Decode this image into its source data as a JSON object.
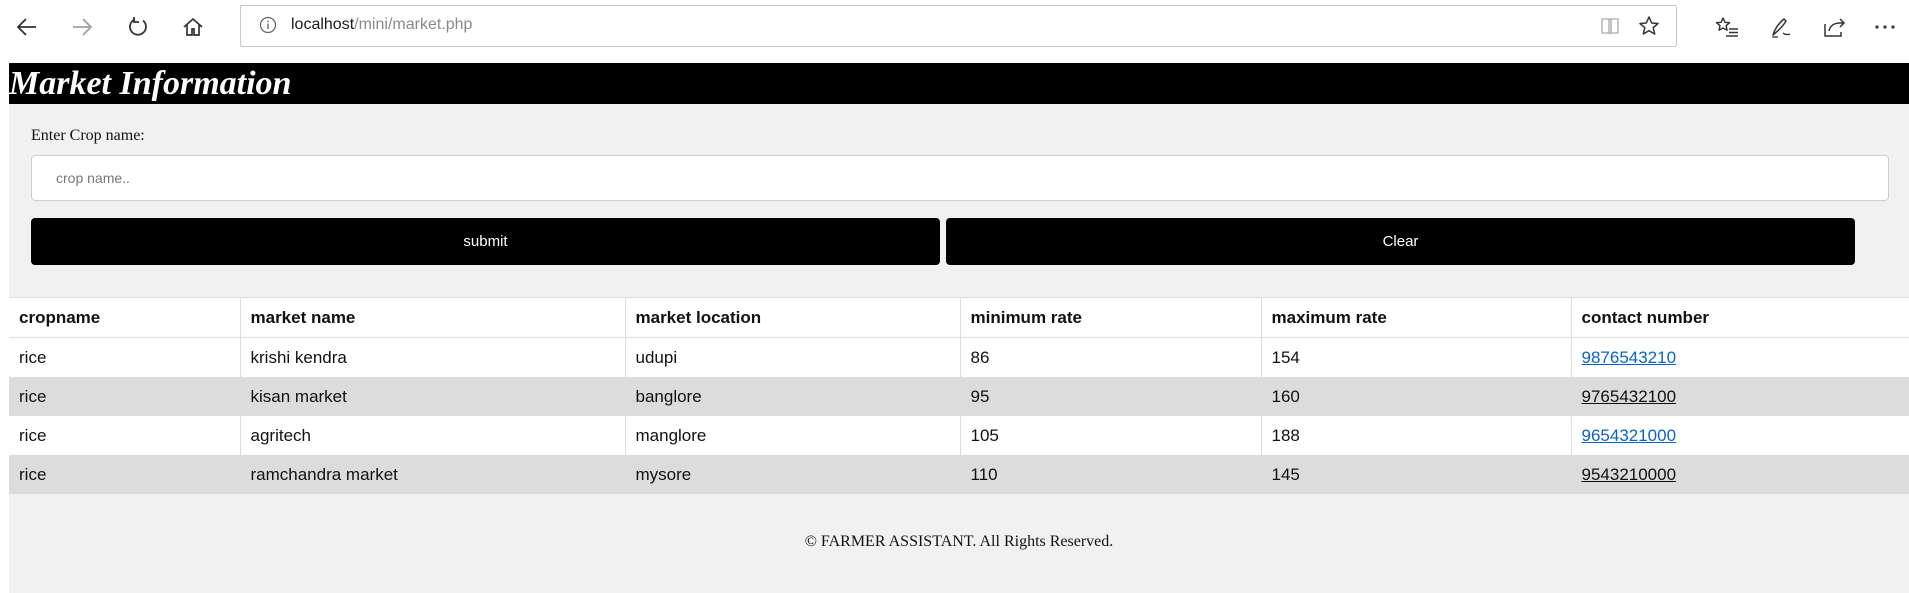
{
  "browser": {
    "url_host": "localhost",
    "url_path": "/mini/market.php"
  },
  "page": {
    "title": "Market Information",
    "search": {
      "label": "Enter Crop name:",
      "placeholder": "crop name.."
    },
    "buttons": {
      "submit": "submit",
      "clear": "Clear"
    },
    "table": {
      "headers": [
        "cropname",
        "market name",
        "market location",
        "minimum rate",
        "maximum rate",
        "contact number"
      ],
      "rows": [
        [
          "rice",
          "krishi kendra",
          "udupi",
          "86",
          "154",
          "9876543210"
        ],
        [
          "rice",
          "kisan market",
          "banglore",
          "95",
          "160",
          "9765432100"
        ],
        [
          "rice",
          "agritech",
          "manglore",
          "105",
          "188",
          "9654321000"
        ],
        [
          "rice",
          "ramchandra market",
          "mysore",
          "110",
          "145",
          "9543210000"
        ]
      ]
    },
    "footer": "© FARMER ASSISTANT. All Rights Reserved."
  }
}
